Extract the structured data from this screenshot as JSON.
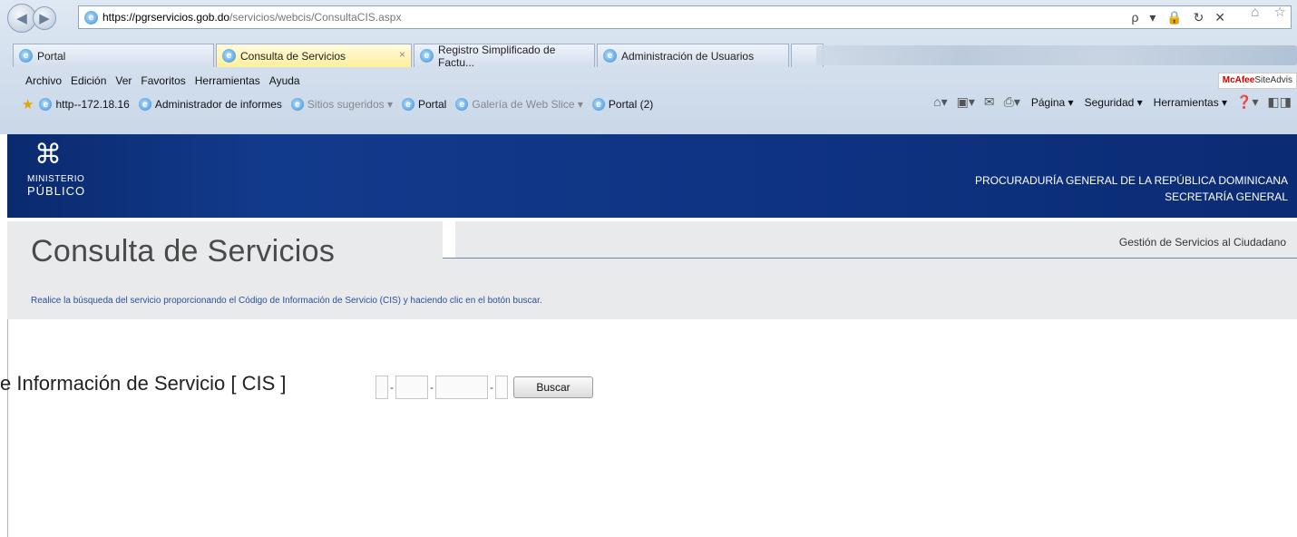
{
  "browser": {
    "url_host": "https://pgrservicios.gob.do",
    "url_path": "/servicios/webcis/ConsultaCIS.aspx",
    "address_tools": "ρ ▾ 🔒 ↻ ✕",
    "home_star": "⌂ ☆",
    "tabs": [
      {
        "label": "Portal"
      },
      {
        "label": "Consulta de Servicios",
        "close": "×"
      },
      {
        "label": "Registro Simplificado de Factu..."
      },
      {
        "label": "Administración de Usuarios"
      }
    ],
    "menu": [
      "Archivo",
      "Edición",
      "Ver",
      "Favoritos",
      "Herramientas",
      "Ayuda"
    ],
    "mcafee_brand": "McAfee",
    "mcafee_rest": "SiteAdvis",
    "favorites": [
      {
        "label": "http--172.18.16"
      },
      {
        "label": "Administrador de informes"
      },
      {
        "label": "Sitios sugeridos ▾"
      },
      {
        "label": "Portal"
      },
      {
        "label": "Galería de Web Slice ▾"
      },
      {
        "label": "Portal (2)"
      }
    ],
    "commands": [
      "Página ▾",
      "Seguridad ▾",
      "Herramientas ▾"
    ]
  },
  "header": {
    "logo_line1": "MINISTERIO",
    "logo_line2": "PÚBLICO",
    "org_line1": "PROCURADURÍA GENERAL DE LA REPÚBLICA DOMINICANA",
    "org_line2": "SECRETARÍA GENERAL"
  },
  "page": {
    "title": "Consulta de Servicios",
    "gestion_link": "Gestión de Servicios al Ciudadano",
    "instructions": "Realice la búsqueda del servicio proporcionando el Código de Información de Servicio (CIS) y haciendo clic en el botón buscar.",
    "cis_label": "e Información de Servicio [ CIS ]",
    "dash": "-",
    "buscar_label": "Buscar"
  }
}
